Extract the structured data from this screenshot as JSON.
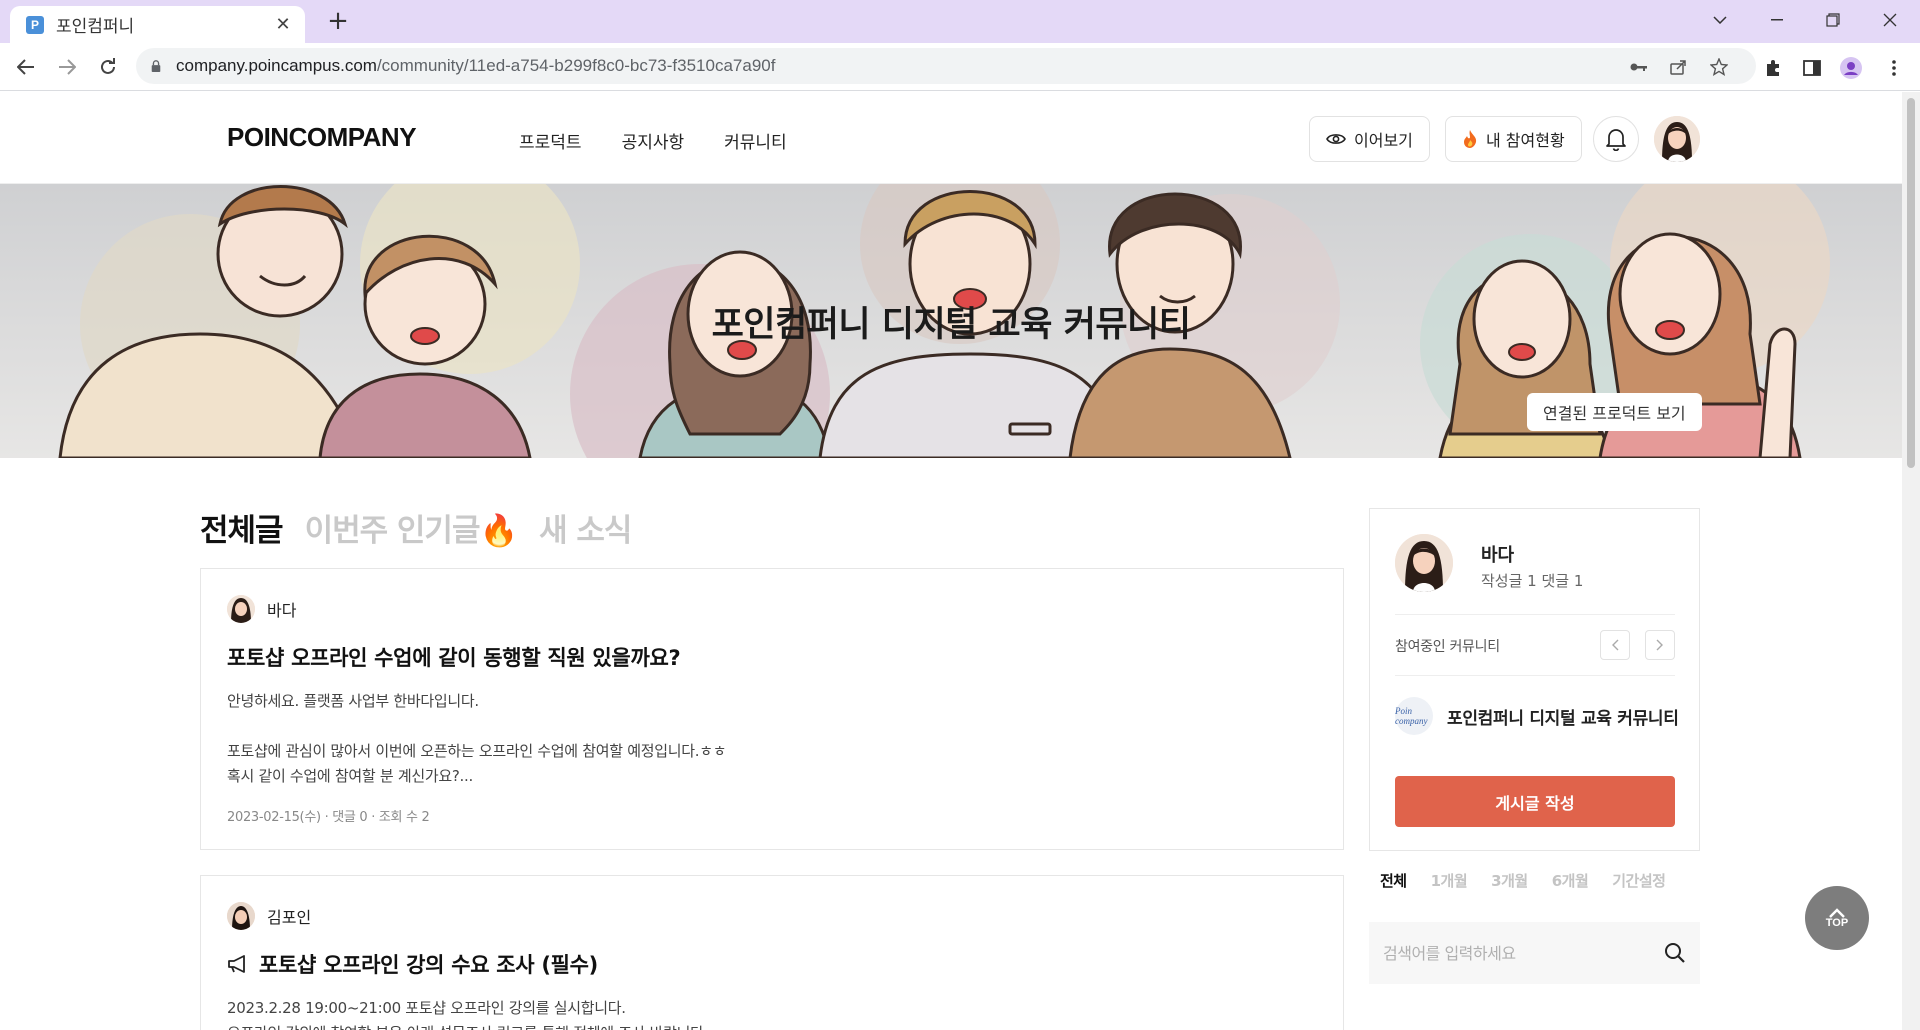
{
  "browser": {
    "tab_title": "포인컴퍼니",
    "url_host": "company.poincampus.com",
    "url_path": "/community/11ed-a754-b299f8c0-bc73-f3510ca7a90f"
  },
  "header": {
    "logo": "POINCOMPANY",
    "nav": [
      "프로덕트",
      "공지사항",
      "커뮤니티"
    ],
    "continue_label": "이어보기",
    "my_participation_label": "내 참여현황"
  },
  "banner": {
    "title": "포인컴퍼니 디지털 교육 커뮤니티",
    "linked_product_label": "연결된 프로덕트 보기"
  },
  "feed": {
    "tabs": [
      {
        "label": "전체글",
        "active": true
      },
      {
        "label": "이번주 인기글🔥",
        "active": false
      },
      {
        "label": "새 소식",
        "active": false
      }
    ],
    "posts": [
      {
        "author": "바다",
        "title": "포토샵 오프라인 수업에 같이 동행할 직원 있을까요?",
        "body": "안녕하세요. 플랫폼 사업부 한바다입니다.\n\n포토샵에 관심이 많아서 이번에 오픈하는 오프라인 수업에 참여할 예정입니다.ㅎㅎ\n혹시 같이 수업에 참여할 분 계신가요?...",
        "meta": "2023-02-15(수) · 댓글 0 · 조회 수 2"
      },
      {
        "author": "김포인",
        "title": "포토샵 오프라인 강의 수요 조사 (필수)",
        "body": "2023.2.28 19:00~21:00 포토샵 오프라인 강의를 실시합니다.\n오프라인 강의에 참여할 분은 아래 설문조사 링크를 통해 전체에 조사 바랍니다."
      }
    ]
  },
  "sidebar": {
    "profile_name": "바다",
    "profile_stats": "작성글 1 댓글 1",
    "communities_label": "참여중인 커뮤니티",
    "community_name": "포인컴퍼니 디지털 교육 커뮤니티",
    "community_logo_text": "Poin company",
    "write_button": "게시글 작성",
    "periods": [
      {
        "label": "전체",
        "active": true
      },
      {
        "label": "1개월",
        "active": false
      },
      {
        "label": "3개월",
        "active": false
      },
      {
        "label": "6개월",
        "active": false
      },
      {
        "label": "기간설정",
        "active": false
      }
    ],
    "search_placeholder": "검색어를 입력하세요"
  },
  "top_button": "TOP",
  "colors": {
    "accent": "#e0634b",
    "tabbar": "#e4d9f7",
    "top_button": "#7d7d7d"
  }
}
